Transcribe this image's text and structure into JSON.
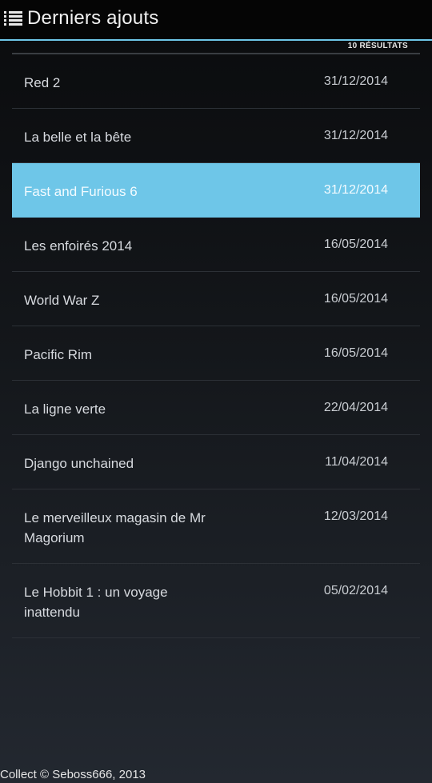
{
  "header": {
    "icon": "list-icon",
    "title": "Derniers ajouts"
  },
  "results_count": "10 RÉSULTATS",
  "accent_color": "#6ec6e8",
  "items": [
    {
      "title": "Red 2",
      "date": "31/12/2014",
      "selected": false
    },
    {
      "title": "La belle et la bête",
      "date": "31/12/2014",
      "selected": false
    },
    {
      "title": "Fast and Furious 6",
      "date": "31/12/2014",
      "selected": true
    },
    {
      "title": "Les enfoirés 2014",
      "date": "16/05/2014",
      "selected": false
    },
    {
      "title": "World War Z",
      "date": "16/05/2014",
      "selected": false
    },
    {
      "title": "Pacific Rim",
      "date": "16/05/2014",
      "selected": false
    },
    {
      "title": "La ligne verte",
      "date": "22/04/2014",
      "selected": false
    },
    {
      "title": "Django unchained",
      "date": "11/04/2014",
      "selected": false
    },
    {
      "title": "Le merveilleux magasin de Mr Magorium",
      "date": "12/03/2014",
      "selected": false
    },
    {
      "title": "Le Hobbit 1 : un voyage inattendu",
      "date": "05/02/2014",
      "selected": false
    }
  ],
  "footer": "Collect © Seboss666, 2013"
}
